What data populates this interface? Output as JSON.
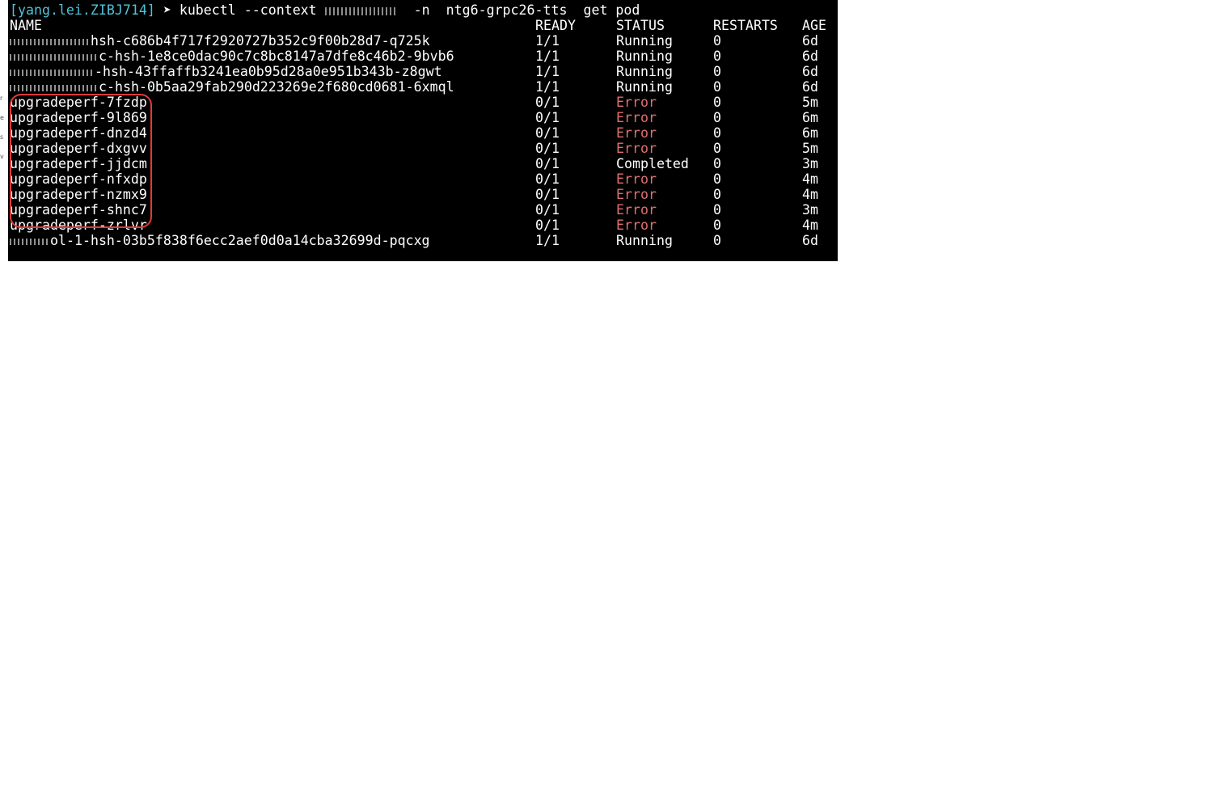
{
  "terminal": {
    "prompt": "[yang.lei.ZIBJ714]",
    "arrow": "➤",
    "command_parts": {
      "cmd": "kubectl --context",
      "flag_n": "-n",
      "namespace": "ntg6-grpc26-tts",
      "action": "get pod"
    }
  },
  "table": {
    "headers": {
      "name": "NAME",
      "ready": "READY",
      "status": "STATUS",
      "restarts": "RESTARTS",
      "age": "AGE"
    },
    "rows": [
      {
        "prefix": "",
        "name": "hsh-c686b4f717f2920727b352c9f00b28d7-q725k",
        "ready": "1/1",
        "status": "Running",
        "restarts": "0",
        "age": "6d",
        "error": false
      },
      {
        "prefix": "",
        "name": "c-hsh-1e8ce0dac90c7c8bc8147a7dfe8c46b2-9bvb6",
        "ready": "1/1",
        "status": "Running",
        "restarts": "0",
        "age": "6d",
        "error": false
      },
      {
        "prefix": "",
        "name": "-hsh-43ffaffb3241ea0b95d28a0e951b343b-z8gwt",
        "ready": "1/1",
        "status": "Running",
        "restarts": "0",
        "age": "6d",
        "error": false
      },
      {
        "prefix": "",
        "name": "c-hsh-0b5aa29fab290d223269e2f680cd0681-6xmql",
        "ready": "1/1",
        "status": "Running",
        "restarts": "0",
        "age": "6d",
        "error": false
      },
      {
        "prefix": "",
        "name": "upgradeperf-7fzdp",
        "ready": "0/1",
        "status": "Error",
        "restarts": "0",
        "age": "5m",
        "error": true
      },
      {
        "prefix": "",
        "name": "upgradeperf-9l869",
        "ready": "0/1",
        "status": "Error",
        "restarts": "0",
        "age": "6m",
        "error": true
      },
      {
        "prefix": "",
        "name": "upgradeperf-dnzd4",
        "ready": "0/1",
        "status": "Error",
        "restarts": "0",
        "age": "6m",
        "error": true
      },
      {
        "prefix": "",
        "name": "upgradeperf-dxgvv",
        "ready": "0/1",
        "status": "Error",
        "restarts": "0",
        "age": "5m",
        "error": true
      },
      {
        "prefix": "",
        "name": "upgradeperf-jjdcm",
        "ready": "0/1",
        "status": "Completed",
        "restarts": "0",
        "age": "3m",
        "error": false
      },
      {
        "prefix": "",
        "name": "upgradeperf-nfxdp",
        "ready": "0/1",
        "status": "Error",
        "restarts": "0",
        "age": "4m",
        "error": true
      },
      {
        "prefix": "",
        "name": "upgradeperf-nzmx9",
        "ready": "0/1",
        "status": "Error",
        "restarts": "0",
        "age": "4m",
        "error": true
      },
      {
        "prefix": "",
        "name": "upgradeperf-shnc7",
        "ready": "0/1",
        "status": "Error",
        "restarts": "0",
        "age": "3m",
        "error": true
      },
      {
        "prefix": "",
        "name": "upgradeperf-zrlvr",
        "ready": "0/1",
        "status": "Error",
        "restarts": "0",
        "age": "4m",
        "error": true
      },
      {
        "prefix": "",
        "name": "ol-1-hsh-03b5f838f6ecc2aef0d0a14cba32699d-pqcxg",
        "ready": "1/1",
        "status": "Running",
        "restarts": "0",
        "age": "6d",
        "error": false
      }
    ]
  },
  "colors": {
    "terminal_bg": "#000000",
    "text": "#ffffff",
    "prompt": "#4fc3d9",
    "error": "#e07070",
    "highlight": "#e03a3a"
  }
}
